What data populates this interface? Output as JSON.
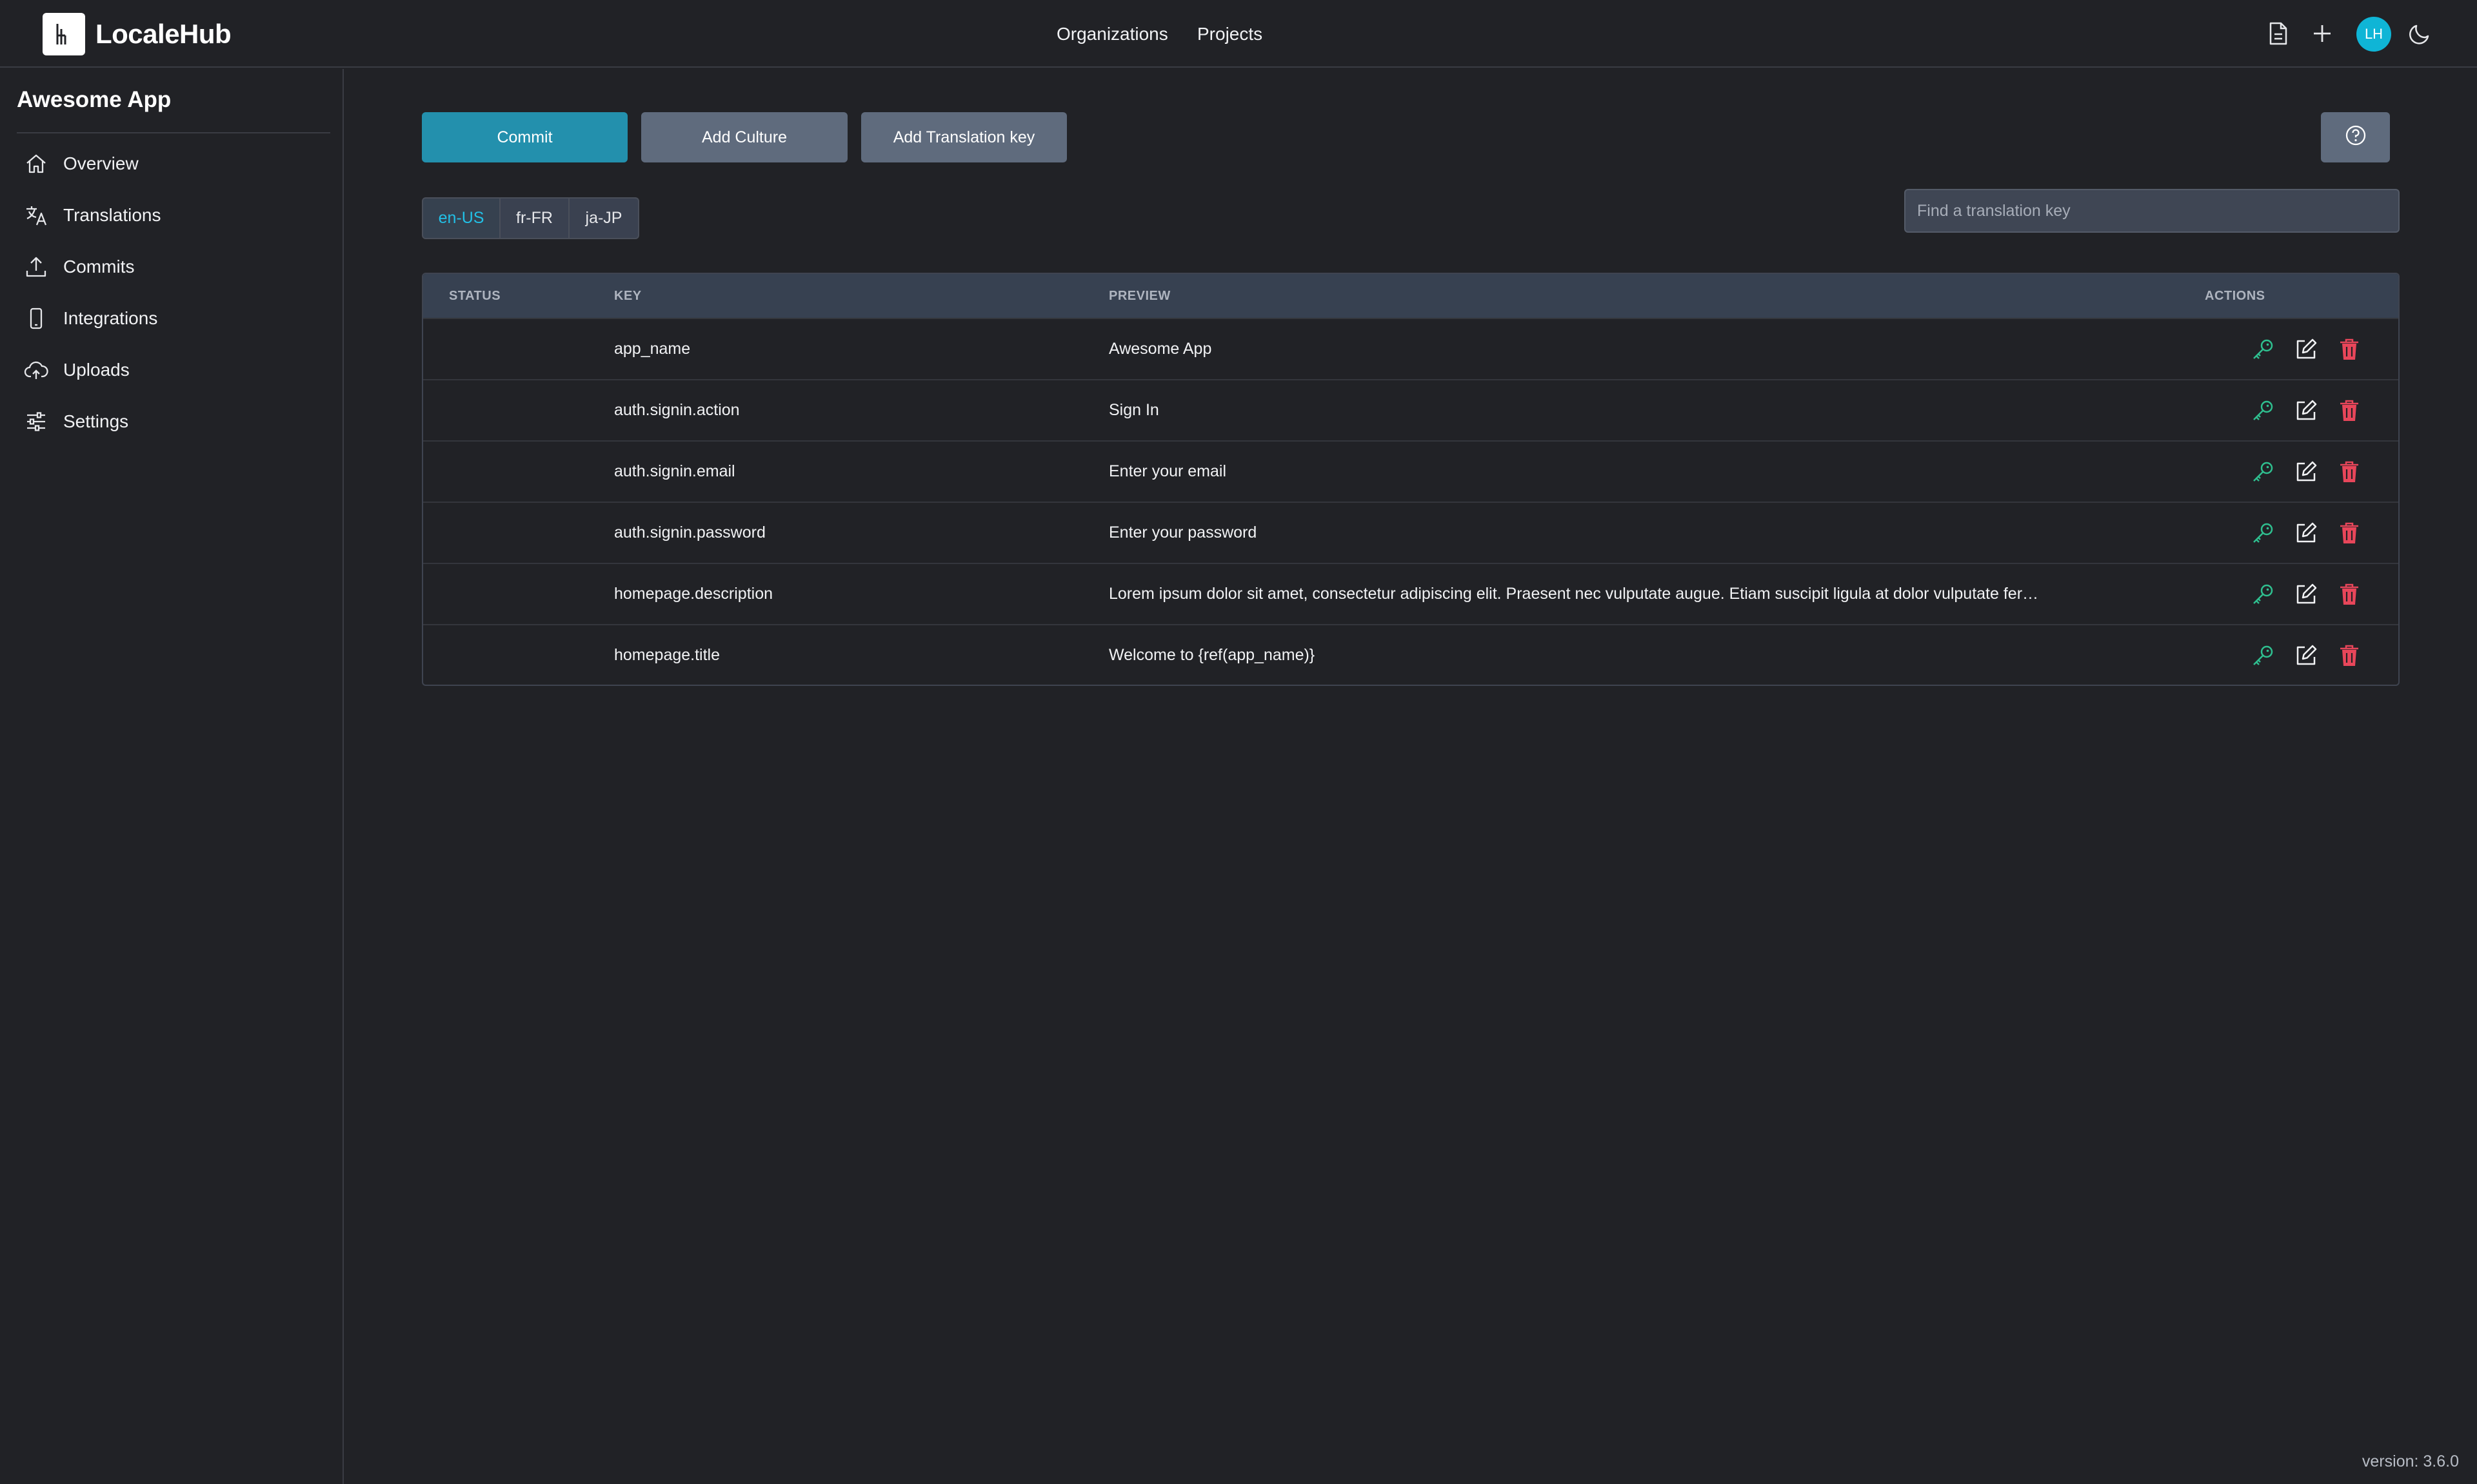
{
  "app": {
    "brand": "LocaleHub",
    "logo_glyph": "lh",
    "nav": {
      "organizations": "Organizations",
      "projects": "Projects"
    },
    "toolbar_icons": [
      "document-icon",
      "plus-icon",
      "moon-icon"
    ],
    "avatar_initials": "LH"
  },
  "sidebar": {
    "project_name": "Awesome App",
    "items": [
      {
        "label": "Overview",
        "icon": "home-icon"
      },
      {
        "label": "Translations",
        "icon": "translate-icon"
      },
      {
        "label": "Commits",
        "icon": "upload-icon"
      },
      {
        "label": "Integrations",
        "icon": "mobile-icon"
      },
      {
        "label": "Uploads",
        "icon": "cloud-upload-icon"
      },
      {
        "label": "Settings",
        "icon": "sliders-icon"
      }
    ]
  },
  "toolbar": {
    "commit_label": "Commit",
    "add_culture_label": "Add Culture",
    "add_key_label": "Add Translation key",
    "help_icon": "question-circle-icon"
  },
  "cultures": {
    "tabs": [
      "en-US",
      "fr-FR",
      "ja-JP"
    ],
    "selected": "en-US"
  },
  "search": {
    "placeholder": "Find a translation key",
    "value": ""
  },
  "table": {
    "headers": {
      "status": "STATUS",
      "key": "KEY",
      "preview": "PREVIEW",
      "actions": "ACTIONS"
    },
    "rows": [
      {
        "status": "",
        "key": "app_name",
        "preview": "Awesome App"
      },
      {
        "status": "",
        "key": "auth.signin.action",
        "preview": "Sign In"
      },
      {
        "status": "",
        "key": "auth.signin.email",
        "preview": "Enter your email"
      },
      {
        "status": "",
        "key": "auth.signin.password",
        "preview": "Enter your password"
      },
      {
        "status": "",
        "key": "homepage.description",
        "preview": "Lorem ipsum dolor sit amet, consectetur adipiscing elit. Praesent nec vulputate augue. Etiam suscipit ligula at dolor vulputate fermentum. …"
      },
      {
        "status": "",
        "key": "homepage.title",
        "preview": "Welcome to {ref(app_name)}"
      }
    ],
    "row_action_icons": [
      "key-icon",
      "edit-icon",
      "trash-icon"
    ]
  },
  "colors": {
    "accent": "#2390ad",
    "key_icon": "#2fbf8f",
    "delete_icon": "#e8465a",
    "avatar": "#0fb5d6"
  },
  "footer": {
    "version": "version: 3.6.0"
  }
}
